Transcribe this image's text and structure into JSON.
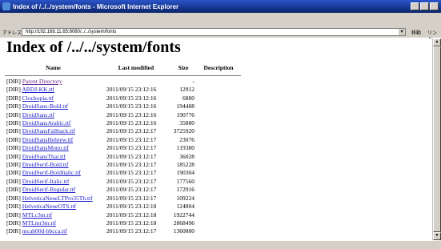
{
  "window": {
    "title": "Index of /../../system/fonts - Microsoft Internet Explorer"
  },
  "address": {
    "label": "アドレス(D)",
    "value": "http://192.168.11.65:8080/../../system/fonts",
    "go_label": "移動",
    "links_label": "リンク"
  },
  "page": {
    "heading": "Index of /../../system/fonts",
    "columns": [
      "Name",
      "Last modified",
      "Size",
      "Description"
    ],
    "parent": {
      "tag": "[DIR]",
      "name": "Parent Directory",
      "date": "",
      "size": "-"
    },
    "rows": [
      {
        "tag": "[DIR]",
        "name": "ARDJ-KK.ttf",
        "date": "2011/09/15 23:12:16",
        "size": "12912"
      },
      {
        "tag": "[DIR]",
        "name": "Clockopia.ttf",
        "date": "2011/09/15 23:12:16",
        "size": "6880"
      },
      {
        "tag": "[DIR]",
        "name": "DroidSans-Bold.ttf",
        "date": "2011/09/15 23:12:16",
        "size": "194488"
      },
      {
        "tag": "[DIR]",
        "name": "DroidSans.ttf",
        "date": "2011/09/15 23:12:16",
        "size": "190776"
      },
      {
        "tag": "[DIR]",
        "name": "DroidSansArabic.ttf",
        "date": "2011/09/15 23:12:16",
        "size": "35880"
      },
      {
        "tag": "[DIR]",
        "name": "DroidSansFallback.ttf",
        "date": "2011/09/15 23:12:17",
        "size": "3725920"
      },
      {
        "tag": "[DIR]",
        "name": "DroidSansHebrew.ttf",
        "date": "2011/09/15 23:12:17",
        "size": "23076"
      },
      {
        "tag": "[DIR]",
        "name": "DroidSansMono.ttf",
        "date": "2011/09/15 23:12:17",
        "size": "119380"
      },
      {
        "tag": "[DIR]",
        "name": "DroidSansThai.ttf",
        "date": "2011/09/15 23:12:17",
        "size": "36028"
      },
      {
        "tag": "[DIR]",
        "name": "DroidSerif-Bold.ttf",
        "date": "2011/09/15 23:12:17",
        "size": "185228"
      },
      {
        "tag": "[DIR]",
        "name": "DroidSerif-BoldItalic.ttf",
        "date": "2011/09/15 23:12:17",
        "size": "190304"
      },
      {
        "tag": "[DIR]",
        "name": "DroidSerif-Italic.ttf",
        "date": "2011/09/15 23:12:17",
        "size": "177560"
      },
      {
        "tag": "[DIR]",
        "name": "DroidSerif-Regular.ttf",
        "date": "2011/09/15 23:12:17",
        "size": "172916"
      },
      {
        "tag": "[DIR]",
        "name": "HelveticaNeueLTPro35Th.ttf",
        "date": "2011/09/15 23:12:17",
        "size": "109224"
      },
      {
        "tag": "[DIR]",
        "name": "HelveticaNeueOTS.ttf",
        "date": "2011/09/15 23:12:18",
        "size": "124804"
      },
      {
        "tag": "[DIR]",
        "name": "MTLc3m.ttf",
        "date": "2011/09/15 23:12:18",
        "size": "1922744"
      },
      {
        "tag": "[DIR]",
        "name": "MTLmr3m.ttf",
        "date": "2011/09/15 23:12:18",
        "size": "2868496"
      },
      {
        "tag": "[DIR]",
        "name": "mcab00d-bbcca.ttf",
        "date": "2011/09/15 23:12:17",
        "size": "1360880"
      }
    ]
  }
}
